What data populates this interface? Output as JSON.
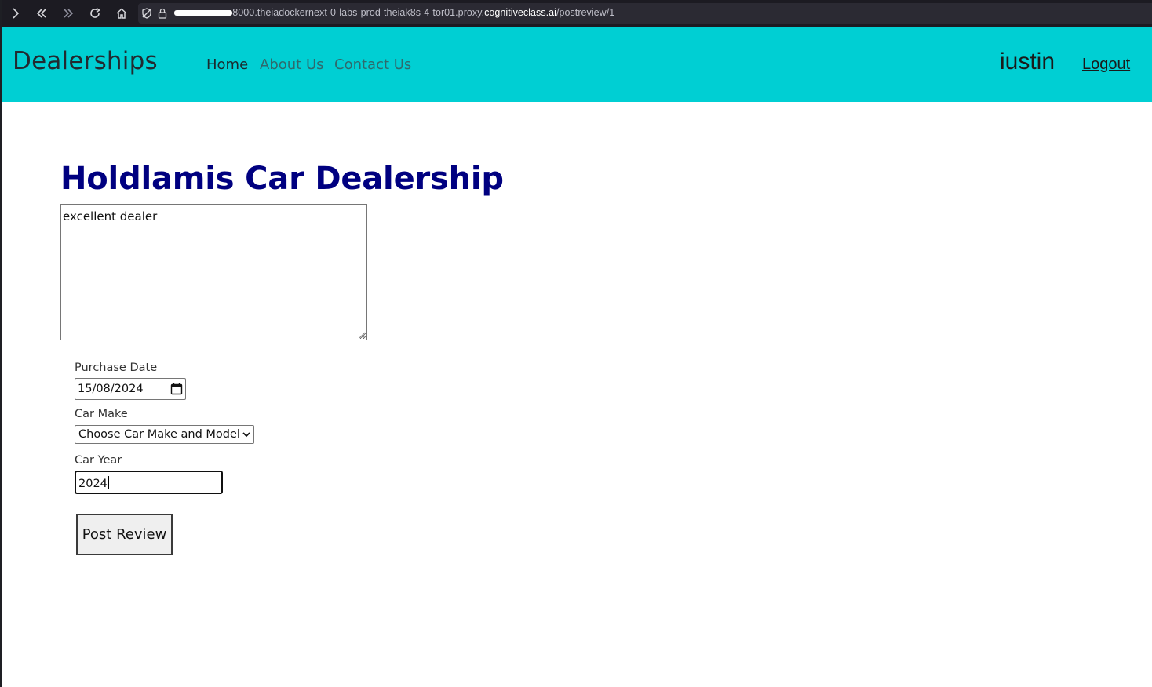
{
  "browser": {
    "url_prefix": "-8000.theiadockernext-0-labs-prod-theiak8s-4-tor01.proxy.",
    "url_domain": "cognitiveclass.ai",
    "url_path": "/postreview/1",
    "icons": [
      "forward-icon",
      "back-history-icon",
      "forward-history-icon",
      "reload-icon",
      "home-icon",
      "tracking-protection-icon",
      "lock-icon"
    ]
  },
  "navbar": {
    "brand": "Dealerships",
    "links": [
      {
        "label": "Home",
        "active": true
      },
      {
        "label": "About Us",
        "active": false
      },
      {
        "label": "Contact Us",
        "active": false
      }
    ],
    "username": "iustin",
    "logout_label": "Logout",
    "background_color": "#00cfd3"
  },
  "main": {
    "title": "Holdlamis Car Dealership",
    "title_color": "#000080",
    "review_text": "excellent dealer",
    "purchase_date_label": "Purchase Date",
    "purchase_date_value": "15/08/2024",
    "car_make_label": "Car Make",
    "car_make_selected": "Choose Car Make and Model",
    "car_year_label": "Car Year",
    "car_year_value": "2024",
    "submit_label": "Post Review"
  }
}
